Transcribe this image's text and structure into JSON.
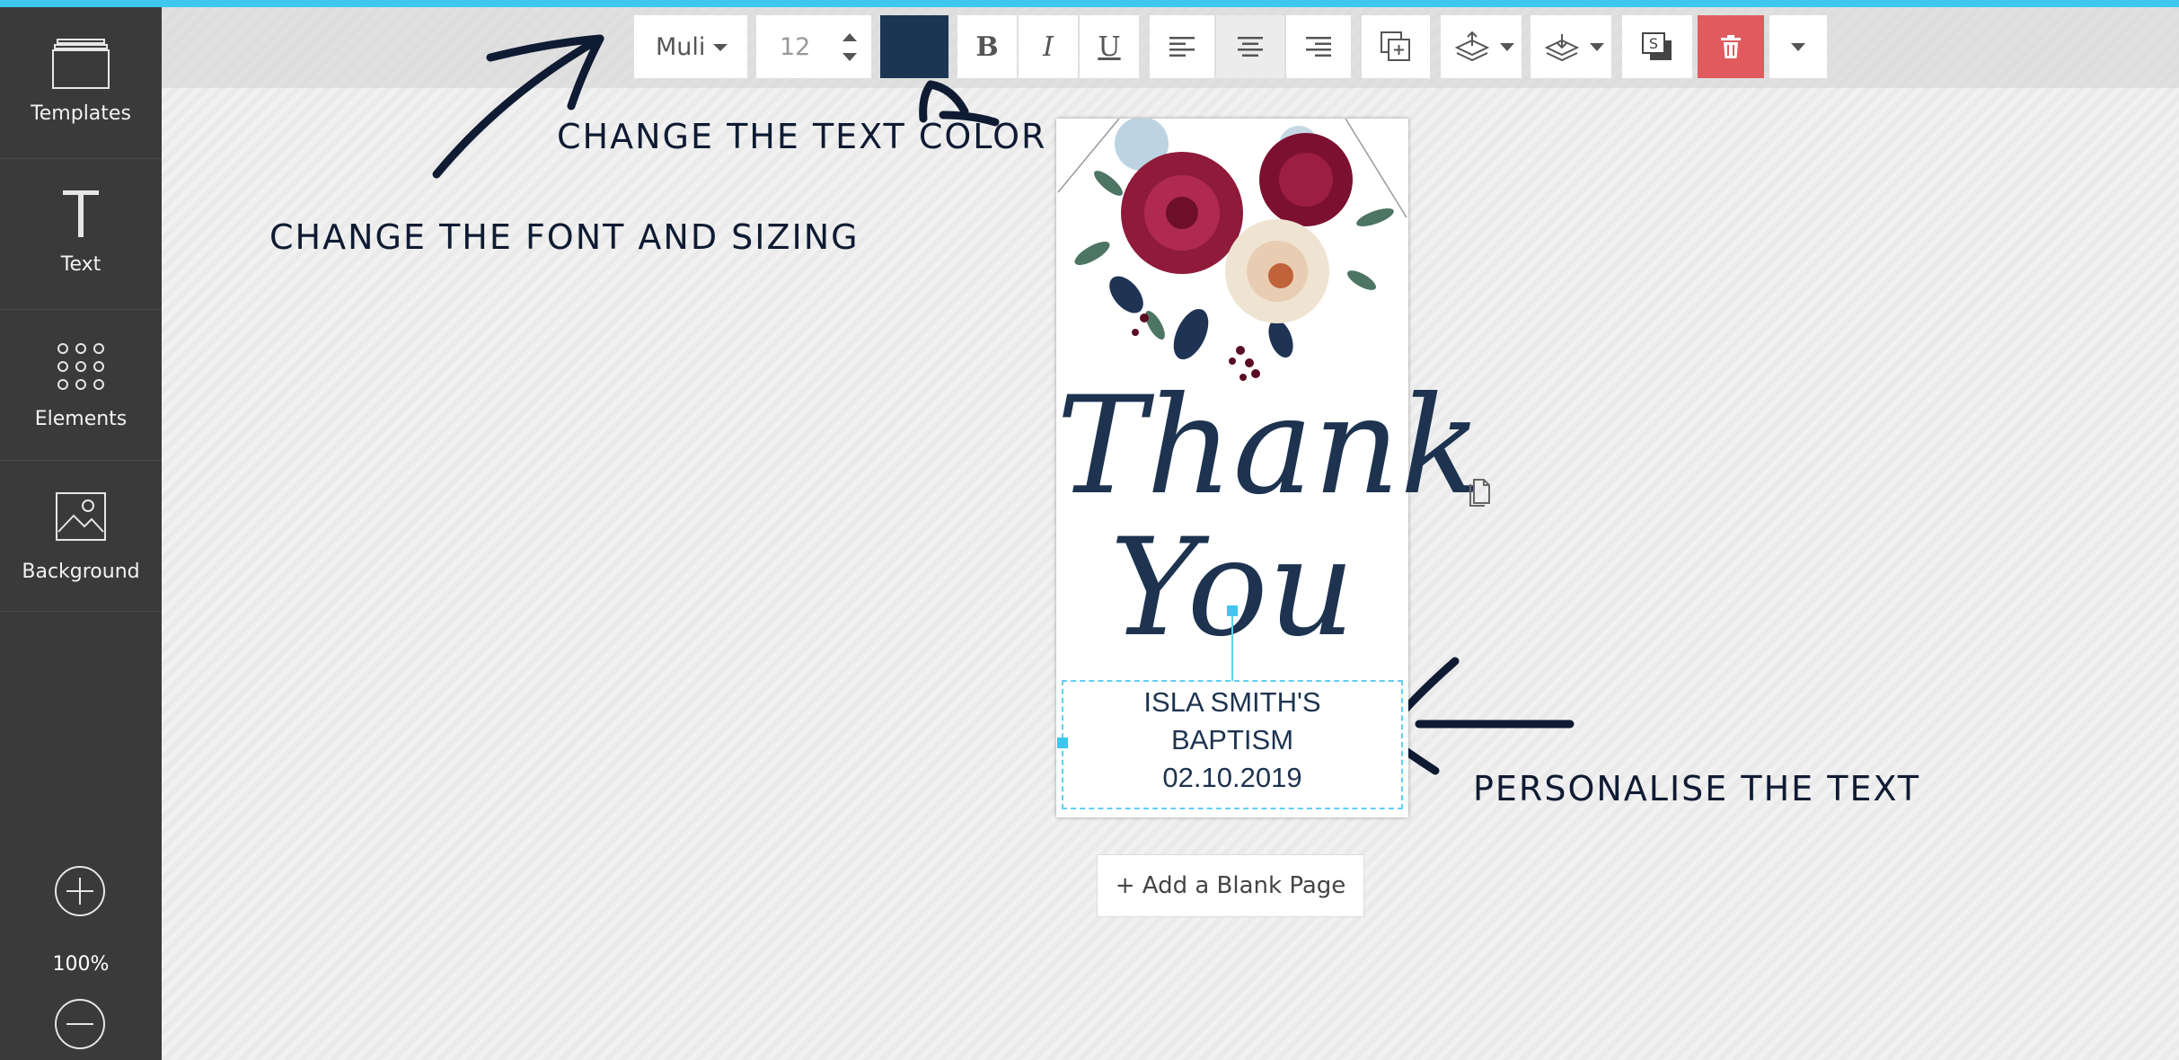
{
  "sidebar": {
    "items": [
      {
        "label": "Templates",
        "icon": "templates-icon"
      },
      {
        "label": "Text",
        "icon": "text-icon"
      },
      {
        "label": "Elements",
        "icon": "elements-icon"
      },
      {
        "label": "Background",
        "icon": "background-icon"
      }
    ],
    "zoom": "100%"
  },
  "toolbar": {
    "font": "Muli",
    "size": "12",
    "color": "#1c3553",
    "bold_label": "B",
    "italic_label": "I",
    "underline_label": "U"
  },
  "canvas": {
    "thank": "Thank",
    "you": "You",
    "lines": [
      "ISLA SMITH'S",
      "BAPTISM",
      "02.10.2019"
    ]
  },
  "annotations": {
    "font": "CHANGE THE FONT AND SIZING",
    "color": "CHANGE THE TEXT COLOR",
    "personalise": "PERSONALISE THE TEXT"
  },
  "add_page": "+ Add a Blank Page",
  "colors": {
    "accent": "#3fc6ee",
    "sidebar": "#3a3a3a",
    "delete": "#e05a5e",
    "ink": "#1d3350"
  }
}
